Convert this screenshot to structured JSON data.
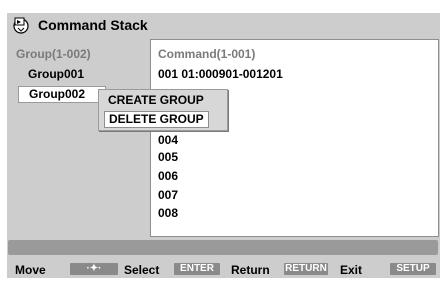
{
  "header": {
    "title": "Command Stack",
    "icon": "command-stack-icon"
  },
  "groups": {
    "header": "Group(1-002)",
    "items": [
      {
        "label": "Group001"
      },
      {
        "label": "Group002"
      }
    ]
  },
  "commands": {
    "header": "Command(1-001)",
    "rows": [
      {
        "label": "001  01:000901-001201"
      },
      {
        "label": "004"
      },
      {
        "label": "005"
      },
      {
        "label": "006"
      },
      {
        "label": "007"
      },
      {
        "label": "008"
      }
    ]
  },
  "popup": {
    "create_label": "CREATE GROUP",
    "delete_label": "DELETE GROUP"
  },
  "footer": {
    "move_label": "Move",
    "move_key": "·✦·",
    "select_label": "Select",
    "select_key": "ENTER",
    "return_label": "Return",
    "return_key": "RETURN",
    "exit_label": "Exit",
    "exit_key": "SETUP"
  },
  "colors": {
    "background": "#cdcdcd",
    "panel": "#ffffff",
    "key_fill": "#8a8a8a",
    "header_text": "#7a7a7a"
  }
}
